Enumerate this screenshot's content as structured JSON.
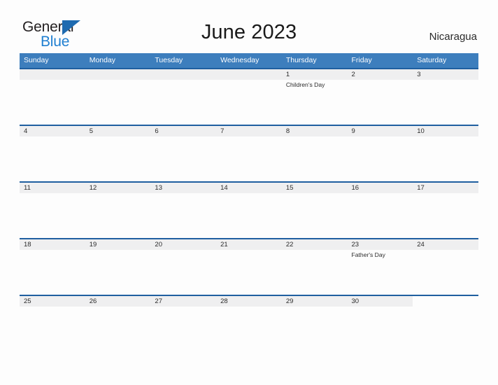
{
  "logo": {
    "text_primary": "General",
    "text_secondary": "Blue",
    "flag_icon": "blue-flag-triangle-icon",
    "color_primary": "#231f20",
    "color_secondary": "#1f7fd0",
    "flag_color": "#1f6bb0"
  },
  "header": {
    "title": "June 2023",
    "country": "Nicaragua"
  },
  "theme": {
    "weekday_header_bg": "#3d7ebd",
    "weekday_header_text": "#ffffff",
    "week_separator": "#1f5fa0",
    "date_bar_bg": "#efeff0",
    "page_bg": "#fdfdfd",
    "text": "#2b2b2b"
  },
  "calendar": {
    "weekdays": [
      "Sunday",
      "Monday",
      "Tuesday",
      "Wednesday",
      "Thursday",
      "Friday",
      "Saturday"
    ],
    "weeks": [
      {
        "cells": [
          {
            "date": "",
            "events": [],
            "state": "empty"
          },
          {
            "date": "",
            "events": [],
            "state": "empty"
          },
          {
            "date": "",
            "events": [],
            "state": "empty"
          },
          {
            "date": "",
            "events": [],
            "state": "empty"
          },
          {
            "date": "1",
            "events": [
              "Children's Day"
            ],
            "state": "day"
          },
          {
            "date": "2",
            "events": [],
            "state": "day"
          },
          {
            "date": "3",
            "events": [],
            "state": "day"
          }
        ]
      },
      {
        "cells": [
          {
            "date": "4",
            "events": [],
            "state": "day"
          },
          {
            "date": "5",
            "events": [],
            "state": "day"
          },
          {
            "date": "6",
            "events": [],
            "state": "day"
          },
          {
            "date": "7",
            "events": [],
            "state": "day"
          },
          {
            "date": "8",
            "events": [],
            "state": "day"
          },
          {
            "date": "9",
            "events": [],
            "state": "day"
          },
          {
            "date": "10",
            "events": [],
            "state": "day"
          }
        ]
      },
      {
        "cells": [
          {
            "date": "11",
            "events": [],
            "state": "day"
          },
          {
            "date": "12",
            "events": [],
            "state": "day"
          },
          {
            "date": "13",
            "events": [],
            "state": "day"
          },
          {
            "date": "14",
            "events": [],
            "state": "day"
          },
          {
            "date": "15",
            "events": [],
            "state": "day"
          },
          {
            "date": "16",
            "events": [],
            "state": "day"
          },
          {
            "date": "17",
            "events": [],
            "state": "day"
          }
        ]
      },
      {
        "cells": [
          {
            "date": "18",
            "events": [],
            "state": "day"
          },
          {
            "date": "19",
            "events": [],
            "state": "day"
          },
          {
            "date": "20",
            "events": [],
            "state": "day"
          },
          {
            "date": "21",
            "events": [],
            "state": "day"
          },
          {
            "date": "22",
            "events": [],
            "state": "day"
          },
          {
            "date": "23",
            "events": [
              "Father's Day"
            ],
            "state": "day"
          },
          {
            "date": "24",
            "events": [],
            "state": "day"
          }
        ]
      },
      {
        "cells": [
          {
            "date": "25",
            "events": [],
            "state": "day"
          },
          {
            "date": "26",
            "events": [],
            "state": "day"
          },
          {
            "date": "27",
            "events": [],
            "state": "day"
          },
          {
            "date": "28",
            "events": [],
            "state": "day"
          },
          {
            "date": "29",
            "events": [],
            "state": "day"
          },
          {
            "date": "30",
            "events": [],
            "state": "day"
          },
          {
            "date": "",
            "events": [],
            "state": "blank"
          }
        ]
      }
    ]
  }
}
